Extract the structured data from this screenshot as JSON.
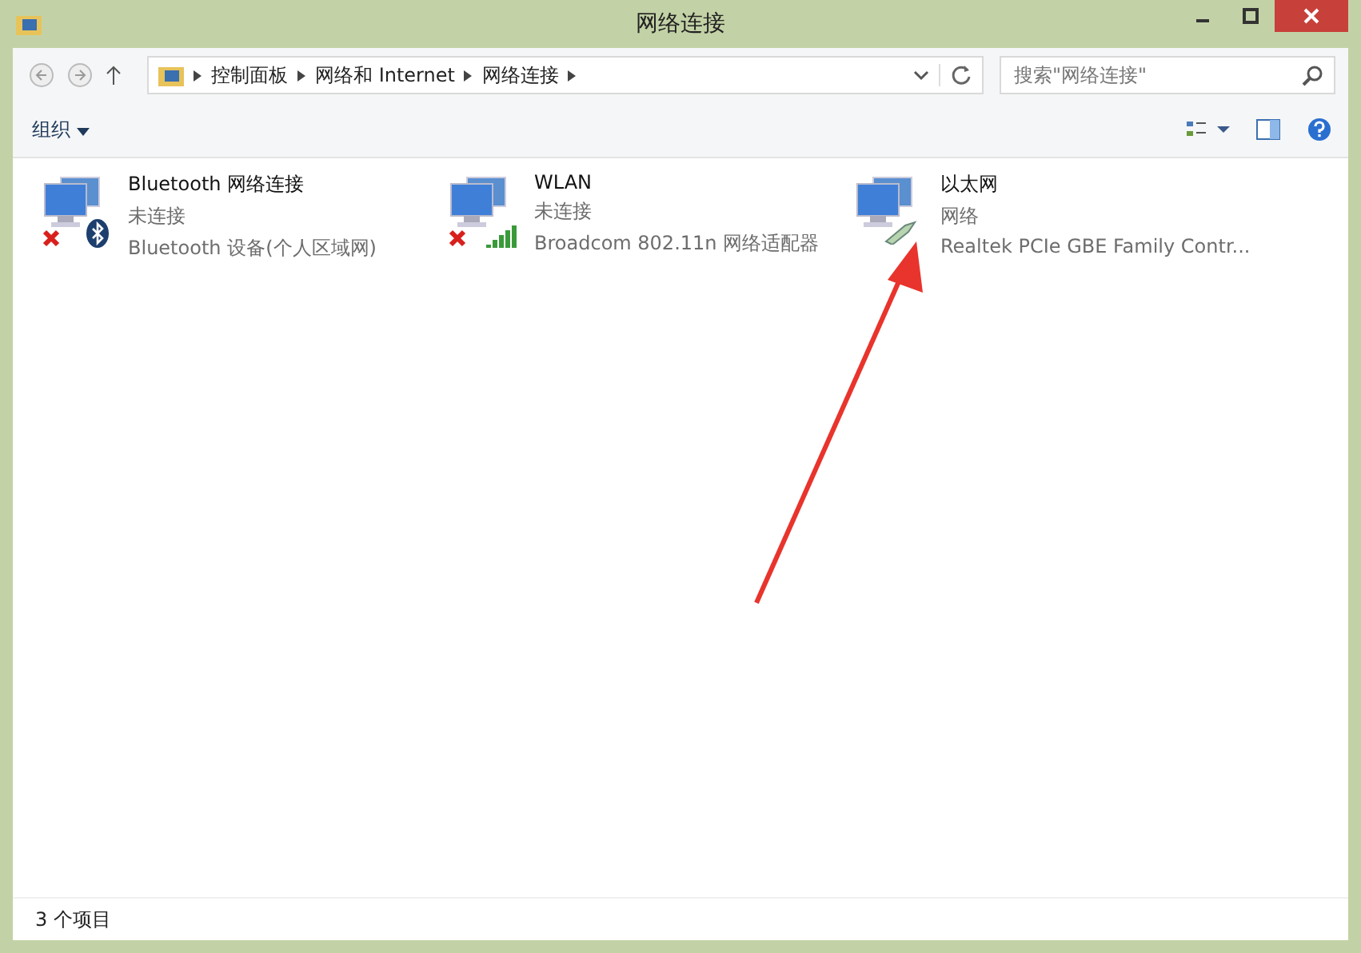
{
  "window": {
    "title": "网络连接"
  },
  "address_bar": {
    "breadcrumbs": [
      "控制面板",
      "网络和 Internet",
      "网络连接"
    ]
  },
  "search": {
    "placeholder": "搜索\"网络连接\""
  },
  "toolbar": {
    "organize": "组织"
  },
  "connections": [
    {
      "kind": "bluetooth",
      "name": "Bluetooth 网络连接",
      "status": "未连接",
      "device": "Bluetooth 设备(个人区域网)",
      "connected": false
    },
    {
      "kind": "wifi",
      "name": "WLAN",
      "status": "未连接",
      "device": "Broadcom 802.11n 网络适配器",
      "connected": false
    },
    {
      "kind": "ethernet",
      "name": "以太网",
      "status": "网络",
      "device": "Realtek PCIe GBE Family Contr...",
      "connected": true
    }
  ],
  "annotation": {
    "arrow": true
  },
  "status_bar": {
    "count": "3 个项目"
  }
}
